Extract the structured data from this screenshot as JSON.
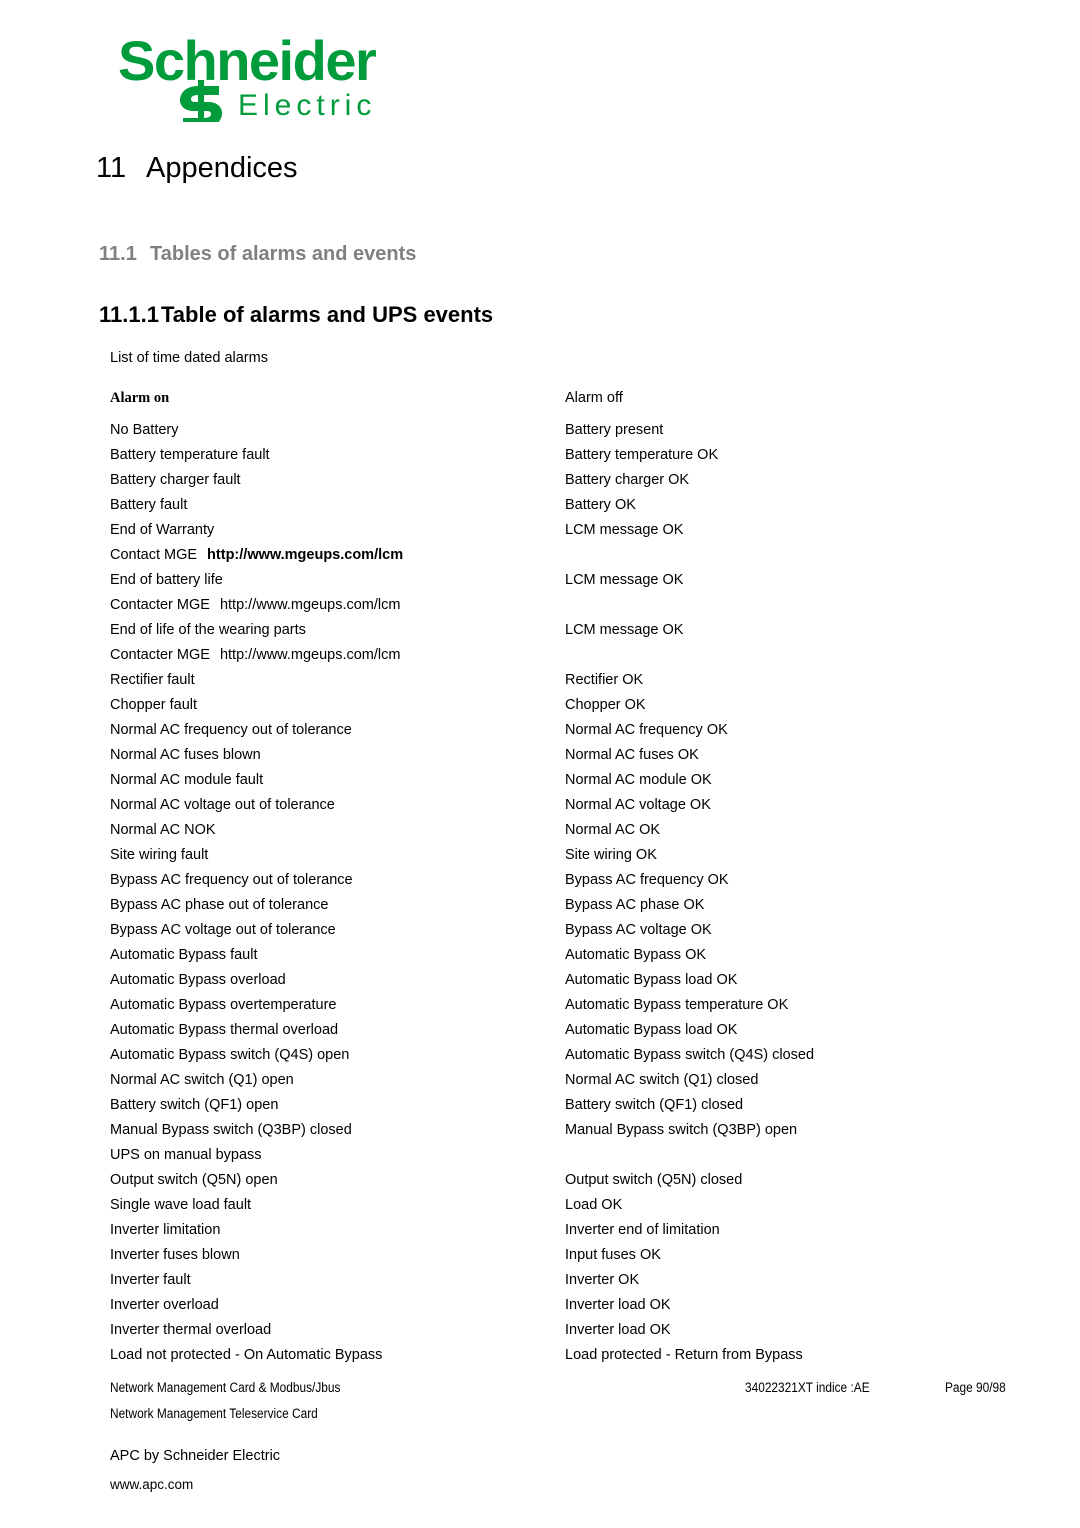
{
  "brand": {
    "logo_text_top": "Schneider",
    "logo_text_bottom": "Electric",
    "logo_color": "#009B3A",
    "company_line": "APC by Schneider Electric",
    "website": "www.apc.com"
  },
  "headings": {
    "chapter_number": "11",
    "chapter_title": "Appendices",
    "section_number": "11.1",
    "section_title": "Tables of alarms and events",
    "subsection_number": "11.1.1",
    "subsection_title": "Table of alarms and UPS events",
    "section_color": "#808080"
  },
  "intro": "List of time dated alarms",
  "table": {
    "header_on": "Alarm on",
    "header_off": "Alarm off",
    "rows": [
      {
        "on": "No Battery",
        "off": "Battery present"
      },
      {
        "on": "Battery temperature fault",
        "off": "Battery temperature OK"
      },
      {
        "on": "Battery charger fault",
        "off": "Battery charger OK"
      },
      {
        "on": "Battery fault",
        "off": "Battery OK"
      },
      {
        "on": "End of Warranty",
        "off": "LCM message OK"
      },
      {
        "on": "Contact MGE",
        "on_url": "http://www.mgeups.com/lcm",
        "on_url_bold": true,
        "off": ""
      },
      {
        "on": "End of battery life",
        "off": "LCM message OK"
      },
      {
        "on": "Contacter MGE",
        "on_url": "http://www.mgeups.com/lcm",
        "on_url_bold": false,
        "off": ""
      },
      {
        "on": "End of life of the wearing parts",
        "off": "LCM message OK"
      },
      {
        "on": "Contacter MGE",
        "on_url": "http://www.mgeups.com/lcm",
        "on_url_bold": false,
        "off": ""
      },
      {
        "on": "Rectifier fault",
        "off": "Rectifier OK"
      },
      {
        "on": "Chopper fault",
        "off": "Chopper OK"
      },
      {
        "on": "Normal AC frequency out of tolerance",
        "off": "Normal AC frequency OK"
      },
      {
        "on": "Normal AC fuses blown",
        "off": "Normal AC fuses OK"
      },
      {
        "on": "Normal AC module fault",
        "off": "Normal AC module OK"
      },
      {
        "on": "Normal AC voltage out of tolerance",
        "off": "Normal AC voltage OK"
      },
      {
        "on": "Normal AC NOK",
        "off": "Normal AC OK"
      },
      {
        "on": "Site wiring fault",
        "off": "Site wiring OK"
      },
      {
        "on": "Bypass AC frequency out of tolerance",
        "off": "Bypass AC frequency OK"
      },
      {
        "on": "Bypass AC phase out of tolerance",
        "off": "Bypass AC phase OK"
      },
      {
        "on": "Bypass AC voltage out of tolerance",
        "off": "Bypass AC voltage OK"
      },
      {
        "on": "Automatic Bypass fault",
        "off": "Automatic Bypass OK"
      },
      {
        "on": "Automatic Bypass overload",
        "off": "Automatic Bypass load OK"
      },
      {
        "on": "Automatic Bypass overtemperature",
        "off": "Automatic Bypass temperature OK"
      },
      {
        "on": "Automatic Bypass thermal overload",
        "off": "Automatic Bypass load OK"
      },
      {
        "on": "Automatic Bypass switch (Q4S) open",
        "off": "Automatic Bypass switch (Q4S) closed"
      },
      {
        "on": "Normal AC switch (Q1) open",
        "off": "Normal AC switch (Q1) closed"
      },
      {
        "on": "Battery switch (QF1) open",
        "off": "Battery switch (QF1) closed"
      },
      {
        "on": "Manual Bypass switch (Q3BP) closed",
        "off": "Manual Bypass switch (Q3BP) open"
      },
      {
        "on": "UPS on manual bypass",
        "off": ""
      },
      {
        "on": "Output switch (Q5N) open",
        "off": "Output switch (Q5N) closed"
      },
      {
        "on": "Single wave load fault",
        "off": "Load OK"
      },
      {
        "on": "Inverter limitation",
        "off": "Inverter end of limitation"
      },
      {
        "on": "Inverter fuses blown",
        "off": "Input fuses OK"
      },
      {
        "on": "Inverter fault",
        "off": "Inverter OK"
      },
      {
        "on": "Inverter overload",
        "off": "Inverter load OK"
      },
      {
        "on": "Inverter thermal overload",
        "off": "Inverter load OK"
      },
      {
        "on": "Load not protected - On Automatic Bypass",
        "off": "Load protected - Return from Bypass"
      }
    ]
  },
  "footer": {
    "line1": "Network Management Card & Modbus/Jbus",
    "line2": "Network Management Teleservice Card",
    "document_code": "34022321XT indice :AE",
    "page_label": "Page 90/98"
  }
}
